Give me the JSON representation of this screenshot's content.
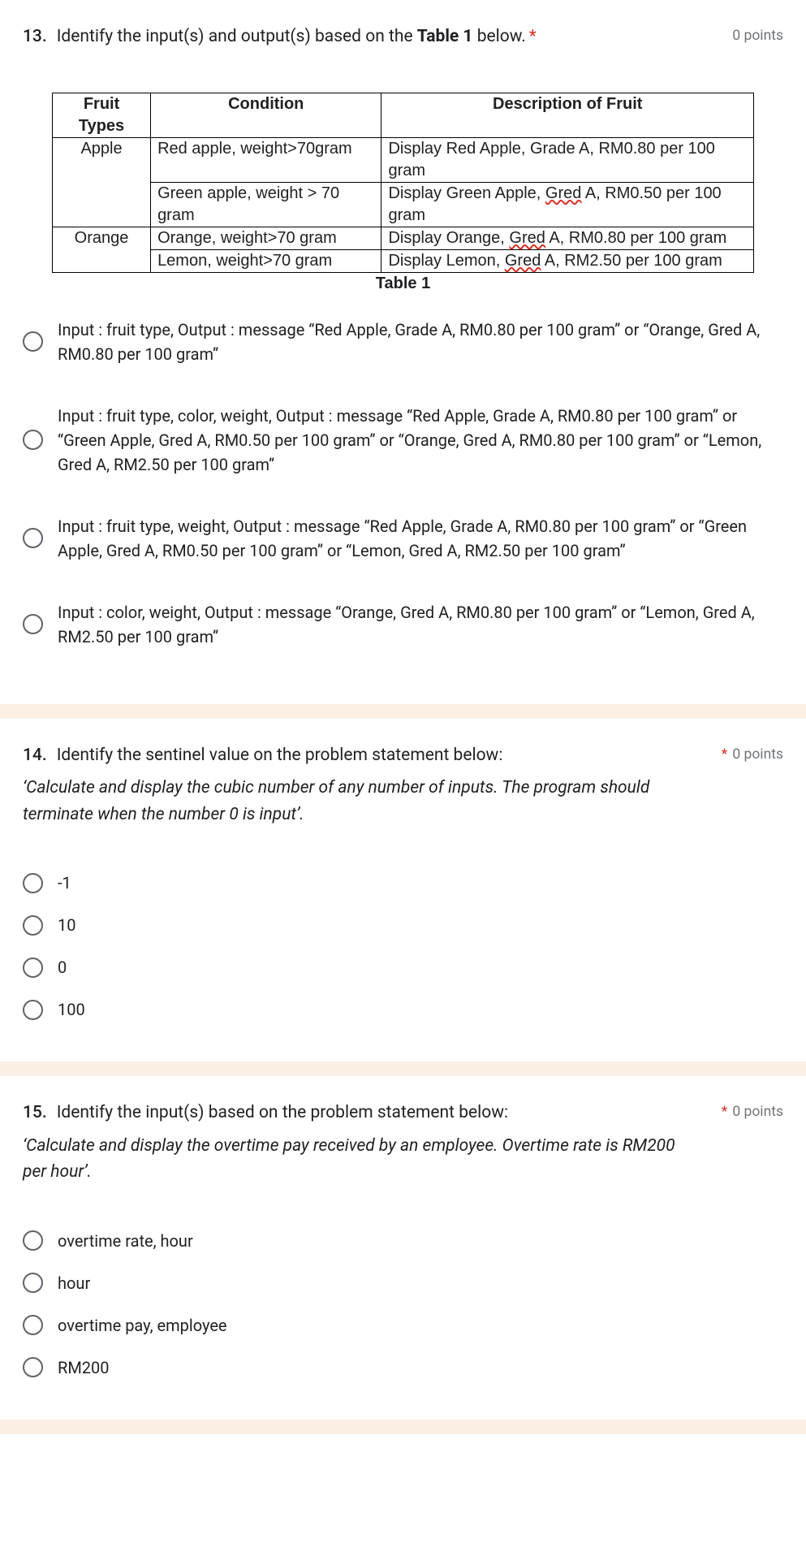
{
  "q13": {
    "number": "13.",
    "title_pre": "Identify the input(s) and output(s) based on the ",
    "title_bold": "Table 1",
    "title_post": " below.",
    "required": "*",
    "points": "0 points",
    "table": {
      "headers": [
        "Fruit Types",
        "Condition",
        "Description of Fruit"
      ],
      "rows": [
        {
          "ft": "Apple",
          "cond": "Red apple, weight>70gram",
          "desc_pre": "Display Red Apple, Grade A, RM0.80 per 100 gram"
        },
        {
          "ft": "",
          "cond": "Green apple, weight > 70 gram",
          "desc_pre": "Display Green Apple, ",
          "gred": "Gred",
          "desc_post": " A, RM0.50 per 100 gram"
        },
        {
          "ft": "Orange",
          "cond": "Orange, weight>70 gram",
          "desc_pre": "Display Orange, ",
          "gred": "Gred",
          "desc_post": " A, RM0.80 per 100 gram"
        },
        {
          "ft": "",
          "cond": "Lemon, weight>70 gram",
          "desc_pre": "Display Lemon, ",
          "gred": "Gred",
          "desc_post": " A, RM2.50 per 100 gram"
        }
      ],
      "caption": "Table 1"
    },
    "options": [
      "Input : fruit type, Output :  message “Red Apple, Grade A, RM0.80 per 100 gram” or “Orange, Gred A, RM0.80 per 100 gram”",
      "Input : fruit type, color, weight, Output :  message “Red Apple, Grade A, RM0.80 per 100 gram” or “Green Apple, Gred A, RM0.50 per 100 gram” or “Orange, Gred A, RM0.80 per 100 gram” or “Lemon, Gred A, RM2.50 per 100 gram”",
      "Input : fruit type, weight, Output :  message “Red Apple, Grade A, RM0.80 per 100 gram” or “Green Apple, Gred A, RM0.50 per 100 gram” or “Lemon, Gred A, RM2.50 per 100 gram”",
      "Input : color, weight, Output :  message “Orange, Gred A, RM0.80 per 100 gram” or “Lemon, Gred A, RM2.50 per 100 gram”"
    ]
  },
  "q14": {
    "number": "14.",
    "title": "Identify the sentinel value on the problem statement below:",
    "sub": "‘Calculate and display the cubic number of any number of inputs.  The program should terminate when the number 0 is input’.",
    "required": "*",
    "points": "0 points",
    "options": [
      "-1",
      "10",
      "0",
      "100"
    ]
  },
  "q15": {
    "number": "15.",
    "title": "Identify the input(s) based on the problem statement below:",
    "sub": "‘Calculate and display the overtime pay received by an employee. Overtime rate is RM200 per hour’.",
    "required": "*",
    "points": "0 points",
    "options": [
      "overtime rate, hour",
      "hour",
      "overtime pay, employee",
      "RM200"
    ]
  }
}
